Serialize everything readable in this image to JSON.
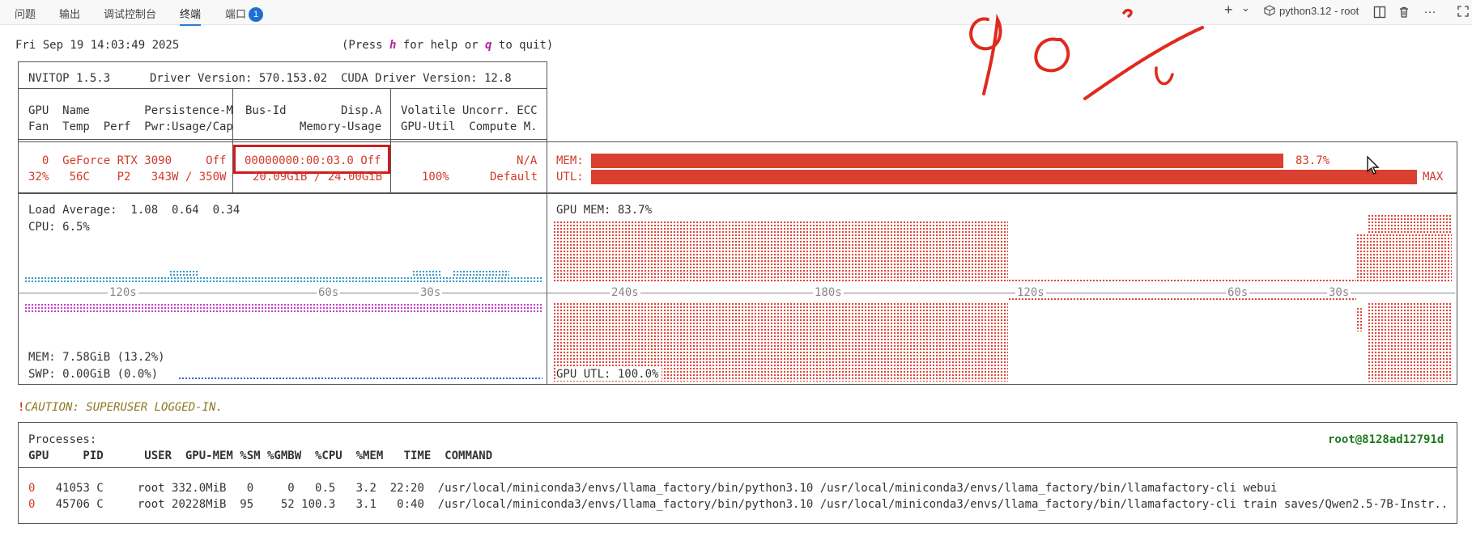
{
  "tabs": [
    {
      "label": "问题"
    },
    {
      "label": "输出"
    },
    {
      "label": "调试控制台"
    },
    {
      "label": "终端"
    },
    {
      "label": "端口",
      "badge": "1"
    }
  ],
  "toolbar": {
    "add": "+",
    "dropdown": "⌄",
    "terminal_name": "python3.12 - root",
    "more": "…"
  },
  "header": {
    "datetime": "Fri Sep 19 14:03:49 2025",
    "help_prefix": "(Press ",
    "help_h": "h",
    "help_mid": " for help or ",
    "help_q": "q",
    "help_suffix": " to quit)"
  },
  "nvitop": {
    "version": "NVITOP 1.5.3",
    "driver": "Driver Version: 570.153.02",
    "cuda": "CUDA Driver Version: 12.8",
    "col1_line1": "GPU  Name        Persistence-M",
    "col1_line2": "Fan  Temp  Perf  Pwr:Usage/Cap",
    "col2_line1": "Bus-Id        Disp.A",
    "col2_line2": "Memory-Usage",
    "col3_line1": "Volatile Uncorr. ECC",
    "col3_line2": "GPU-Util  Compute M."
  },
  "gpu": {
    "row1_left": "  0  GeForce RTX 3090     Off",
    "row2_left": "32%   56C    P2   343W / 350W",
    "bus_id": "00000000:00:03.0 Off",
    "mem_usage": "20.09GiB / 24.00GiB",
    "ecc": "N/A",
    "util": "100%",
    "compute_mode": "Default",
    "mem_label": "MEM:",
    "mem_pct": "83.7%",
    "mem_fraction": 0.837,
    "utl_label": "UTL:",
    "utl_max": "MAX",
    "utl_fraction": 1.0
  },
  "host": {
    "load_avg": "Load Average:  1.08  0.64  0.34",
    "cpu": "CPU: 6.5%",
    "mem": "MEM: 7.58GiB (13.2%)",
    "swp": "SWP: 0.00GiB (0.0%)",
    "ticks": [
      "120s",
      "60s",
      "30s"
    ]
  },
  "gpu_graph": {
    "mem_label": "GPU MEM: 83.7%",
    "utl_label": "GPU UTL: 100.0%",
    "ticks": [
      "240s",
      "180s",
      "120s",
      "60s",
      "30s"
    ]
  },
  "caution": {
    "bang": "!",
    "text": "CAUTION: SUPERUSER LOGGED-IN."
  },
  "processes": {
    "title": "Processes:",
    "user_host": "root@8128ad12791d",
    "header": "GPU     PID      USER  GPU-MEM %SM %GMBW  %CPU  %MEM   TIME  COMMAND",
    "rows": [
      {
        "gpu": "0",
        "rest": "   41053 C     root 332.0MiB   0     0   0.5   3.2  22:20  /usr/local/miniconda3/envs/llama_factory/bin/python3.10 /usr/local/miniconda3/envs/llama_factory/bin/llamafactory-cli webui"
      },
      {
        "gpu": "0",
        "rest": "   45706 C     root 20228MiB  95    52 100.3   3.1   0:40  /usr/local/miniconda3/envs/llama_factory/bin/python3.10 /usr/local/miniconda3/envs/llama_factory/bin/llamafactory-cli train saves/Qwen2.5-7B-Instr.."
      }
    ]
  },
  "annotation": {
    "text": "90%"
  },
  "colors": {
    "accent_red": "#d9402f",
    "cpu_blue": "#3b9acb",
    "magenta": "#c83fd0",
    "tab_active": "#2b7bd4"
  }
}
